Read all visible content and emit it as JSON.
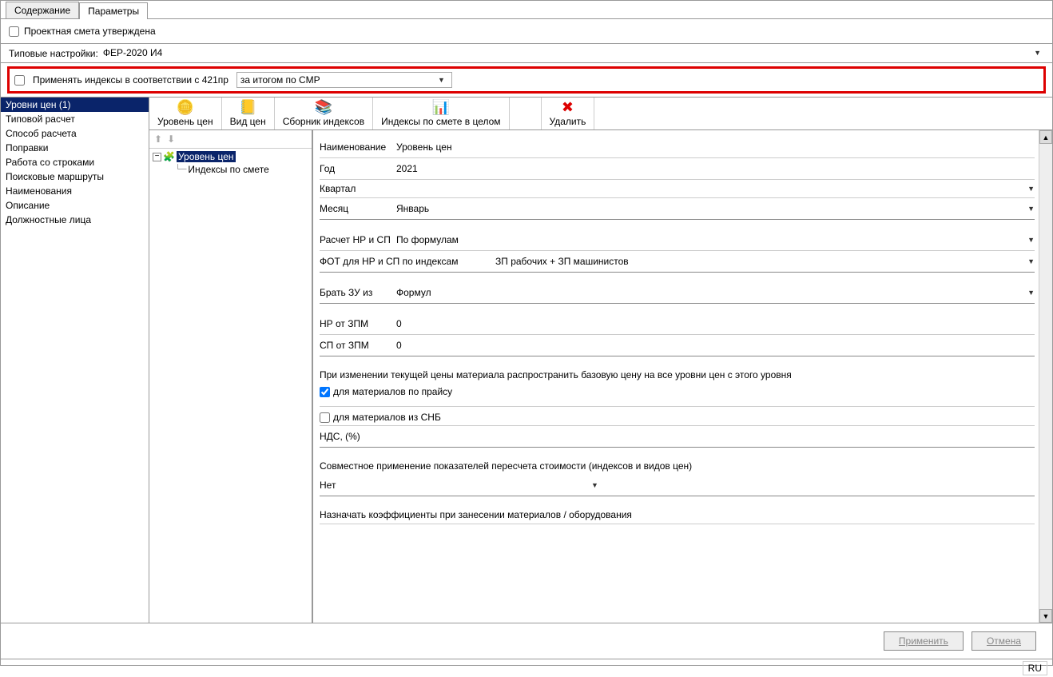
{
  "tabs": {
    "content": "Содержание",
    "params": "Параметры"
  },
  "approved": {
    "label": "Проектная смета утверждена"
  },
  "typeSettings": {
    "label": "Типовые настройки:",
    "value": "ФЕР-2020 И4"
  },
  "applyIndexes": {
    "label": "Применять индексы в соответствии с 421пр",
    "value": "за итогом по СМР"
  },
  "sidebar": [
    "Уровни цен (1)",
    "Типовой расчет",
    "Способ расчета",
    "Поправки",
    "Работа со строками",
    "Поисковые маршруты",
    "Наименования",
    "Описание",
    "Должностные лица"
  ],
  "toolbar": {
    "level": "Уровень цен",
    "viewPrices": "Вид цен",
    "indexCollection": "Сборник индексов",
    "indexesTotal": "Индексы по смете в целом",
    "delete": "Удалить"
  },
  "tree": {
    "root": "Уровень цен",
    "child": "Индексы по смете"
  },
  "form": {
    "nameLabel": "Наименование",
    "nameValue": "Уровень цен",
    "yearLabel": "Год",
    "yearValue": "2021",
    "quarterLabel": "Квартал",
    "quarterValue": "",
    "monthLabel": "Месяц",
    "monthValue": "Январь",
    "nrspLabel": "Расчет НР и СП",
    "nrspValue": "По формулам",
    "fotLabel": "ФОТ для НР и СП по индексам",
    "fotValue": "ЗП рабочих + ЗП машинистов",
    "zuLabel": "Брать ЗУ из",
    "zuValue": "Формул",
    "nrZpmLabel": "НР от ЗПМ",
    "nrZpmValue": "0",
    "spZpmLabel": "СП от ЗПМ",
    "spZpmValue": "0",
    "propagateLabel": "При изменении текущей цены материала распространить базовую цену на все уровни цен с этого уровня",
    "matPriceLabel": "для материалов по прайсу",
    "matSnbLabel": "для материалов из СНБ",
    "ndsLabel": "НДС, (%)",
    "ndsValue": "",
    "jointLabel": "Совместное применение показателей пересчета стоимости (индексов и видов цен)",
    "jointValue": "Нет",
    "assignLabel": "Назначать коэффициенты при занесении материалов / оборудования"
  },
  "footer": {
    "apply": "Применить",
    "cancel": "Отмена"
  },
  "status": {
    "lang": "RU"
  }
}
